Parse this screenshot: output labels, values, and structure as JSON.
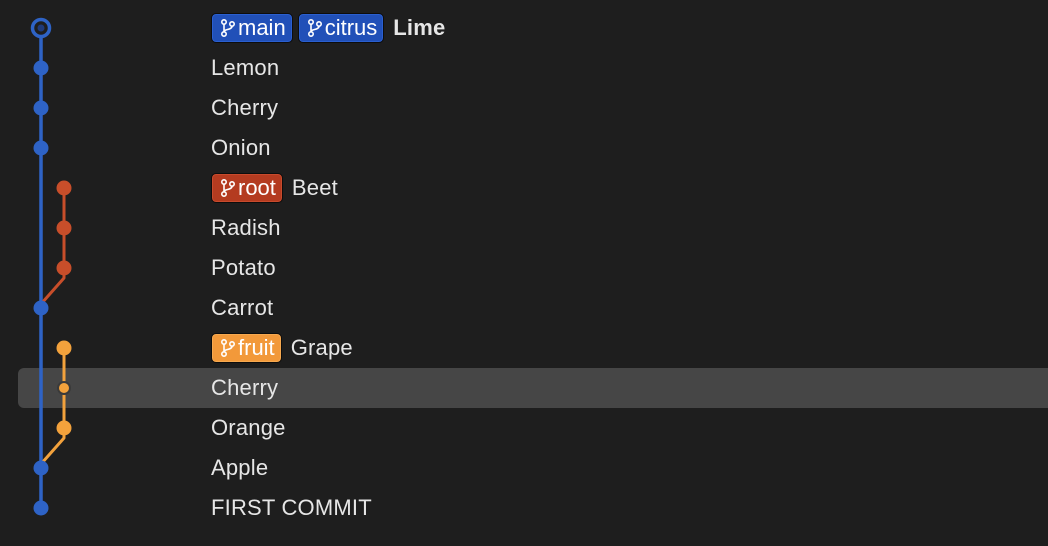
{
  "colors": {
    "main_lane": "#2e63c6",
    "root_lane": "#c84e2a",
    "fruit_lane": "#f3a23c",
    "selection": "#464646",
    "text": "#e6e6e6"
  },
  "commits": [
    {
      "message": "Lime",
      "bold": true,
      "lane": 0,
      "head": true,
      "branches": [
        {
          "name": "main",
          "color": "blue"
        },
        {
          "name": "citrus",
          "color": "blue"
        }
      ]
    },
    {
      "message": "Lemon",
      "lane": 0,
      "branches": []
    },
    {
      "message": "Cherry",
      "lane": 0,
      "branches": []
    },
    {
      "message": "Onion",
      "lane": 0,
      "branches": []
    },
    {
      "message": "Beet",
      "lane": 1,
      "branches": [
        {
          "name": "root",
          "color": "red"
        }
      ]
    },
    {
      "message": "Radish",
      "lane": 1,
      "branches": []
    },
    {
      "message": "Potato",
      "lane": 1,
      "branches": []
    },
    {
      "message": "Carrot",
      "lane": 0,
      "branches": []
    },
    {
      "message": "Grape",
      "lane": 1,
      "branches": [
        {
          "name": "fruit",
          "color": "orange"
        }
      ]
    },
    {
      "message": "Cherry",
      "lane": 1,
      "selected": true,
      "branches": []
    },
    {
      "message": "Orange",
      "lane": 1,
      "branches": []
    },
    {
      "message": "Apple",
      "lane": 0,
      "branches": []
    },
    {
      "message": "FIRST COMMIT",
      "lane": 0,
      "branches": []
    }
  ],
  "icons": {
    "branch": "git-branch-icon",
    "commit": "commit-dot-icon",
    "head": "head-commit-ring-icon"
  }
}
